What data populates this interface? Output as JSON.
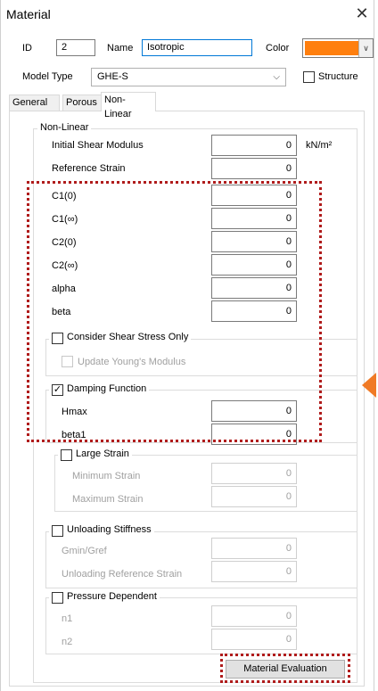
{
  "window": {
    "title": "Material",
    "close_glyph": "✕"
  },
  "header": {
    "id_label": "ID",
    "id_value": "2",
    "name_label": "Name",
    "name_value": "Isotropic",
    "color_label": "Color",
    "color_value": "#ff7f0e",
    "model_type_label": "Model Type",
    "model_type_value": "GHE-S",
    "structure_label": "Structure",
    "structure_checked": false
  },
  "tabs": [
    {
      "label": "General"
    },
    {
      "label": "Porous"
    },
    {
      "label": "Non-Linear"
    }
  ],
  "active_tab": "Non-Linear",
  "nonlinear": {
    "group_label": "Non-Linear",
    "initial_shear_modulus": {
      "label": "Initial Shear Modulus",
      "value": "0",
      "unit": "kN/m²"
    },
    "reference_strain": {
      "label": "Reference Strain",
      "value": "0"
    },
    "params": [
      {
        "label": "C1(0)",
        "value": "0"
      },
      {
        "label": "C1(∞)",
        "value": "0"
      },
      {
        "label": "C2(0)",
        "value": "0"
      },
      {
        "label": "C2(∞)",
        "value": "0"
      },
      {
        "label": "alpha",
        "value": "0"
      },
      {
        "label": "beta",
        "value": "0"
      }
    ],
    "consider_shear": {
      "label": "Consider Shear Stress Only",
      "checked": false
    },
    "update_young": {
      "label": "Update Young's Modulus",
      "checked": false
    },
    "damping": {
      "label": "Damping Function",
      "checked": true,
      "check_glyph": "✓",
      "hmax": {
        "label": "Hmax",
        "value": "0"
      },
      "beta1": {
        "label": "beta1",
        "value": "0"
      }
    },
    "large_strain": {
      "label": "Large Strain",
      "checked": false,
      "min": {
        "label": "Minimum Strain",
        "value": "0"
      },
      "max": {
        "label": "Maximum Strain",
        "value": "0"
      }
    },
    "unloading": {
      "label": "Unloading Stiffness",
      "checked": false,
      "gmin": {
        "label": "Gmin/Gref",
        "value": "0"
      },
      "ref": {
        "label": "Unloading Reference Strain",
        "value": "0"
      }
    },
    "pressure": {
      "label": "Pressure Dependent",
      "checked": false,
      "n1": {
        "label": "n1",
        "value": "0"
      },
      "n2": {
        "label": "n2",
        "value": "0"
      }
    },
    "evaluation_button": "Material Evaluation"
  },
  "icons": {
    "combo_arrow": "chevron-down-icon",
    "swatch_arrow": "chevron-down-icon"
  },
  "glyphs": {
    "chevron": "⌵",
    "swatch_chevron": "∨"
  },
  "colors": {
    "highlight": "#b01c1c",
    "callout": "#f07a26",
    "focus": "#0078d7"
  }
}
